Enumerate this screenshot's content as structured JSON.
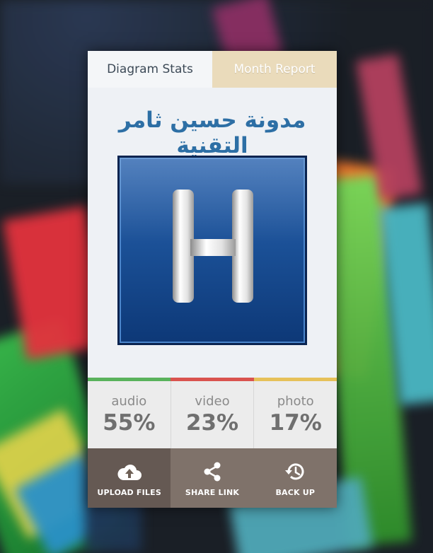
{
  "tabs": [
    {
      "label": "Diagram Stats",
      "active": true
    },
    {
      "label": "Month Report",
      "active": false
    }
  ],
  "title": "مدونة حسين ثامر التقنية",
  "logo_letter": "H",
  "progress_colors": [
    "#59b25c",
    "#d9534f",
    "#e6c15a"
  ],
  "stats": [
    {
      "label": "audio",
      "value": "55%"
    },
    {
      "label": "video",
      "value": "23%"
    },
    {
      "label": "photo",
      "value": "17%"
    }
  ],
  "actions": [
    {
      "label": "UPLOAD FILES",
      "icon": "cloud-upload-icon"
    },
    {
      "label": "SHARE LINK",
      "icon": "share-icon"
    },
    {
      "label": "BACK UP",
      "icon": "history-icon"
    }
  ]
}
